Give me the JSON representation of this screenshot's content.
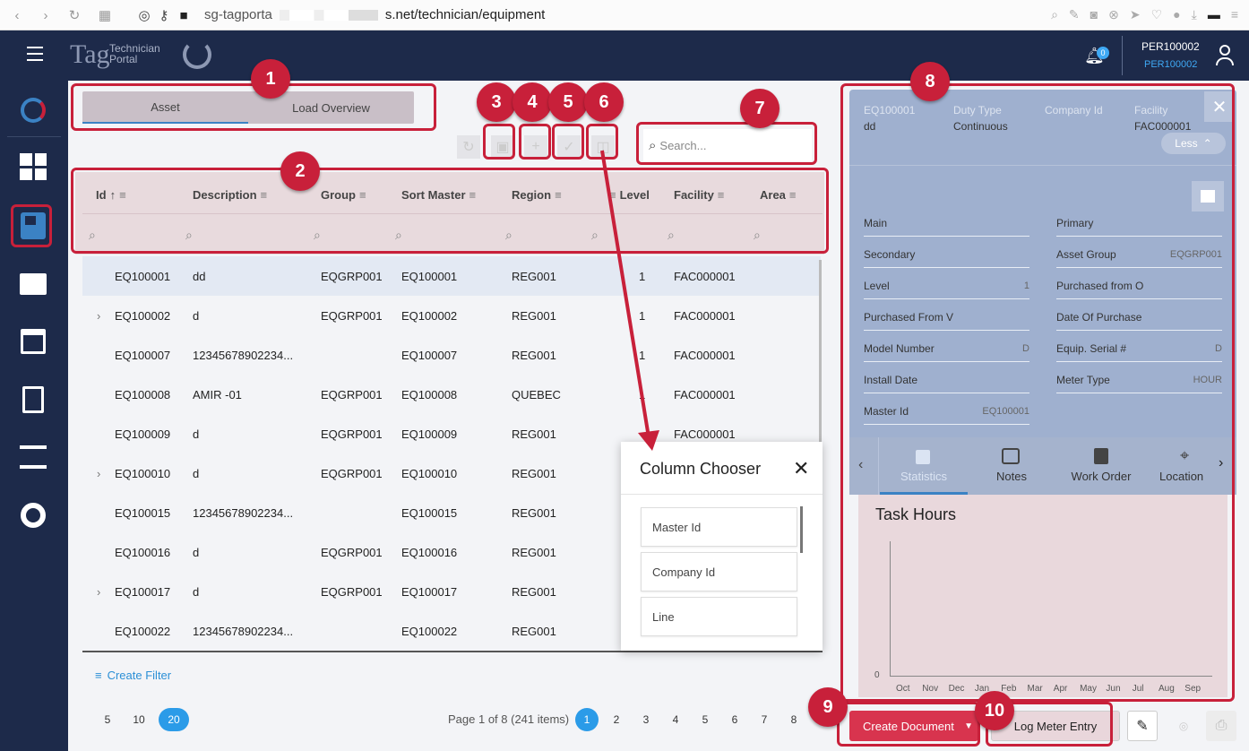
{
  "browser": {
    "url_prefix": "sg-tagporta",
    "url_suffix": "s.net/technician/equipment"
  },
  "header": {
    "logo_text": "Tag",
    "logo_sub1": "Technician",
    "logo_sub2": "Portal",
    "notification_count": "0",
    "user_id": "PER100002",
    "user_sub": "PER100002"
  },
  "tabs": [
    "Asset",
    "Load Overview"
  ],
  "search": {
    "placeholder": "Search..."
  },
  "columns": [
    "Id",
    "Description",
    "Group",
    "Sort Master",
    "Region",
    "Level",
    "Facility",
    "Area"
  ],
  "rows": [
    {
      "id": "EQ100001",
      "desc": "dd",
      "group": "EQGRP001",
      "sort": "EQ100001",
      "region": "REG001",
      "level": "1",
      "facility": "FAC000001",
      "expand": false
    },
    {
      "id": "EQ100002",
      "desc": "d",
      "group": "EQGRP001",
      "sort": "EQ100002",
      "region": "REG001",
      "level": "1",
      "facility": "FAC000001",
      "expand": true
    },
    {
      "id": "EQ100007",
      "desc": "12345678902234...",
      "group": "",
      "sort": "EQ100007",
      "region": "REG001",
      "level": "1",
      "facility": "FAC000001",
      "expand": false
    },
    {
      "id": "EQ100008",
      "desc": "AMIR -01",
      "group": "EQGRP001",
      "sort": "EQ100008",
      "region": "QUEBEC",
      "level": "1",
      "facility": "FAC000001",
      "expand": false
    },
    {
      "id": "EQ100009",
      "desc": "d",
      "group": "EQGRP001",
      "sort": "EQ100009",
      "region": "REG001",
      "level": "",
      "facility": "FAC000001",
      "expand": false
    },
    {
      "id": "EQ100010",
      "desc": "d",
      "group": "EQGRP001",
      "sort": "EQ100010",
      "region": "REG001",
      "level": "",
      "facility": "",
      "expand": true
    },
    {
      "id": "EQ100015",
      "desc": "12345678902234...",
      "group": "",
      "sort": "EQ100015",
      "region": "REG001",
      "level": "",
      "facility": "",
      "expand": false
    },
    {
      "id": "EQ100016",
      "desc": "d",
      "group": "EQGRP001",
      "sort": "EQ100016",
      "region": "REG001",
      "level": "",
      "facility": "",
      "expand": false
    },
    {
      "id": "EQ100017",
      "desc": "d",
      "group": "EQGRP001",
      "sort": "EQ100017",
      "region": "REG001",
      "level": "",
      "facility": "",
      "expand": true
    },
    {
      "id": "EQ100022",
      "desc": "12345678902234...",
      "group": "",
      "sort": "EQ100022",
      "region": "REG001",
      "level": "",
      "facility": "",
      "expand": false
    }
  ],
  "create_filter": "Create Filter",
  "page_sizes": [
    "5",
    "10",
    "20"
  ],
  "pager_info": "Page 1 of 8 (241 items)",
  "pages": [
    "1",
    "2",
    "3",
    "4",
    "5",
    "6",
    "7",
    "8"
  ],
  "column_chooser": {
    "title": "Column Chooser",
    "items": [
      "Master Id",
      "Company Id",
      "Line"
    ]
  },
  "detail": {
    "head_labels": [
      "EQ100001",
      "Duty Type",
      "Company Id",
      "Facility"
    ],
    "head_values": [
      "dd",
      "Continuous",
      "",
      "FAC000001"
    ],
    "less_label": "Less",
    "fields_left": [
      {
        "label": "Main",
        "value": ""
      },
      {
        "label": "Secondary",
        "value": ""
      },
      {
        "label": "Level",
        "value": "1"
      },
      {
        "label": "Purchased From V",
        "value": ""
      },
      {
        "label": "Model Number",
        "value": "D"
      },
      {
        "label": "Install Date",
        "value": ""
      },
      {
        "label": "Master Id",
        "value": "EQ100001"
      }
    ],
    "fields_right": [
      {
        "label": "Primary",
        "value": ""
      },
      {
        "label": "Asset Group",
        "value": "EQGRP001"
      },
      {
        "label": "Purchased from O",
        "value": ""
      },
      {
        "label": "Date Of Purchase",
        "value": ""
      },
      {
        "label": "Equip. Serial #",
        "value": "D"
      },
      {
        "label": "Meter Type",
        "value": "HOUR"
      }
    ],
    "bottom_tabs": [
      "Statistics",
      "Notes",
      "Work Order",
      "Location"
    ]
  },
  "task_hours": {
    "title": "Task Hours",
    "zero": "0",
    "months": [
      "Oct",
      "Nov",
      "Dec",
      "Jan",
      "Feb",
      "Mar",
      "Apr",
      "May",
      "Jun",
      "Jul",
      "Aug",
      "Sep"
    ]
  },
  "buttons": {
    "create_document": "Create Document",
    "log_meter": "Log Meter Entry"
  },
  "callouts": [
    "1",
    "2",
    "3",
    "4",
    "5",
    "6",
    "7",
    "8",
    "9",
    "10"
  ],
  "colors": {
    "accent": "#c8203a",
    "nav": "#1d2a4a",
    "link": "#2b8fd6"
  }
}
